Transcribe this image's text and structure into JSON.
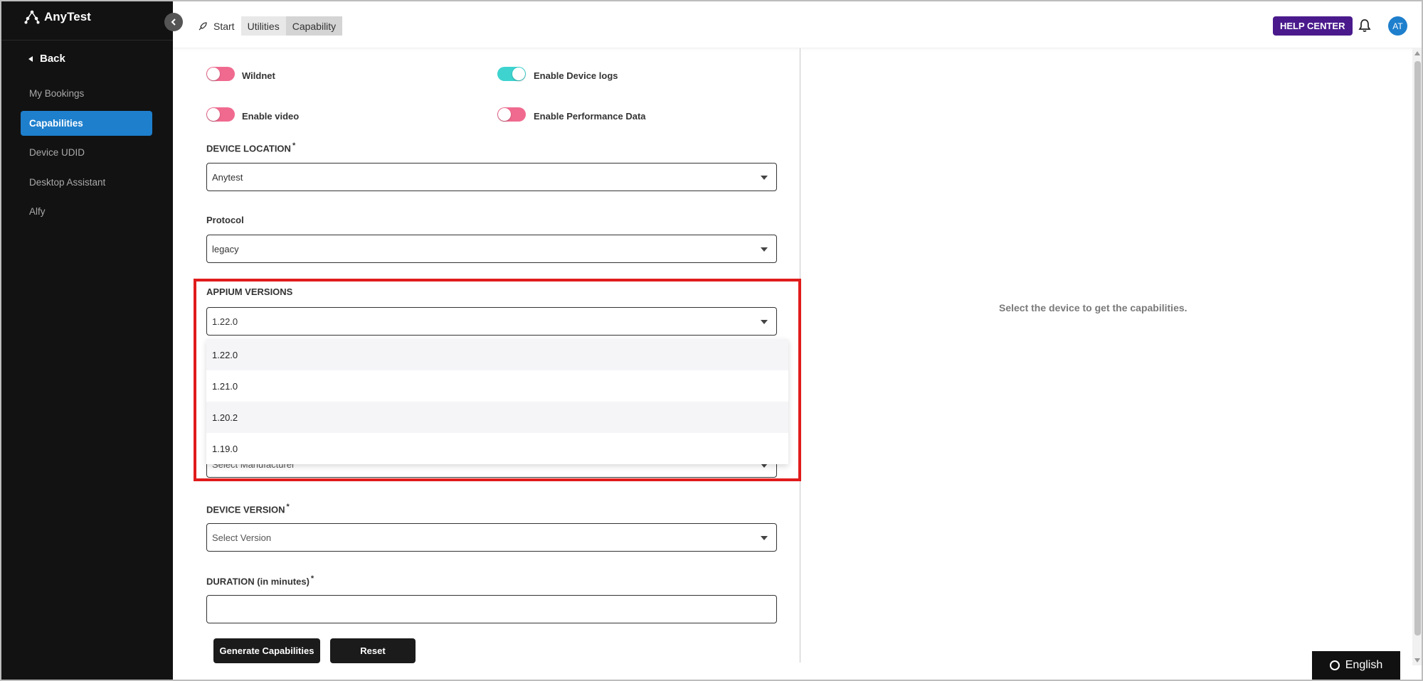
{
  "app": {
    "name": "AnyTest"
  },
  "sidebar": {
    "back_label": "Back",
    "items": [
      {
        "label": "My Bookings",
        "active": false
      },
      {
        "label": "Capabilities",
        "active": true
      },
      {
        "label": "Device UDID",
        "active": false
      },
      {
        "label": "Desktop Assistant",
        "active": false
      },
      {
        "label": "Alfy",
        "active": false
      }
    ]
  },
  "header": {
    "breadcrumbs": [
      "Start",
      "Utilities",
      "Capability"
    ],
    "help_label": "HELP CENTER",
    "avatar_initials": "AT"
  },
  "toggles": [
    {
      "label": "Wildnet",
      "on": false
    },
    {
      "label": "Enable Device logs",
      "on": true
    },
    {
      "label": "Enable video",
      "on": false
    },
    {
      "label": "Enable Performance Data",
      "on": false
    }
  ],
  "fields": {
    "device_location": {
      "label": "DEVICE LOCATION",
      "required": "*",
      "value": "Anytest"
    },
    "protocol": {
      "label": "Protocol",
      "value": "legacy"
    },
    "appium_versions": {
      "label": "APPIUM VERSIONS",
      "value": "1.22.0",
      "options": [
        "1.22.0",
        "1.21.0",
        "1.20.2",
        "1.19.0"
      ]
    },
    "manufacturer": {
      "placeholder": "Select Manufacturer"
    },
    "device_version": {
      "label": "DEVICE VERSION",
      "required": "*",
      "placeholder": "Select Version"
    },
    "duration": {
      "label": "DURATION (in minutes)",
      "required": "*",
      "value": ""
    }
  },
  "buttons": {
    "generate": "Generate Capabilities",
    "reset": "Reset"
  },
  "right_panel": {
    "message": "Select the device to get the capabilities."
  },
  "language": {
    "label": "English"
  },
  "colors": {
    "accent": "#1e7fcd",
    "help": "#4a1a8c",
    "toggle_on": "#3ed3cf",
    "toggle_off": "#f06a8f",
    "highlight": "#e01c1c"
  }
}
